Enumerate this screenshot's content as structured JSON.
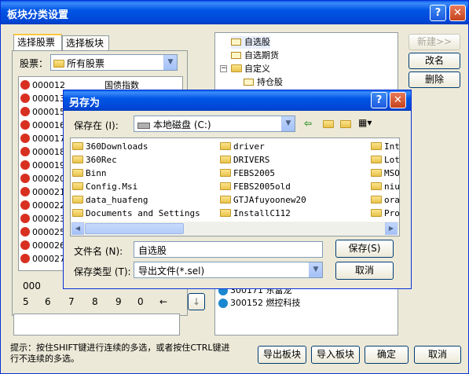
{
  "main": {
    "title": "板块分类设置",
    "help": "?",
    "close": "✕",
    "tabs": [
      "选择股票",
      "选择板块"
    ],
    "stock_label": "股票：",
    "stock_combo": "所有股票",
    "codes": [
      "000012",
      "000013",
      "000015",
      "000016",
      "000017",
      "000018",
      "000019",
      "000020",
      "000021",
      "000022",
      "000023",
      "000025",
      "000026",
      "000027"
    ],
    "first_name": "国债指数",
    "keypad": [
      "000",
      "5",
      "6",
      "7",
      "8",
      "9",
      "0",
      "←"
    ],
    "tree": [
      {
        "label": "自选股",
        "kind": "env"
      },
      {
        "label": "自选期货",
        "kind": "env"
      },
      {
        "label": "自定义",
        "kind": "custom"
      },
      {
        "label": "持仓股",
        "kind": "env"
      }
    ],
    "tree_bottom": [
      {
        "code": "300171",
        "name": "东富龙"
      },
      {
        "code": "300152",
        "name": "燃控科技"
      }
    ],
    "right_buttons": [
      "新建>>",
      "改名",
      "删除"
    ],
    "hint": "提示：按住SHIFT键进行连续的多选，或者按住CTRL键进行不连续的多选。",
    "bottom_buttons": [
      "导出板块",
      "导入板块",
      "确定",
      "取消"
    ]
  },
  "dialog": {
    "title": "另存为",
    "save_in_label": "保存在 (I):",
    "location": "本地磁盘 (C:)",
    "col1": [
      "360Downloads",
      "360Rec",
      "Binn",
      "Config.Msi",
      "data_huafeng",
      "Documents and Settings"
    ],
    "col2": [
      "driver",
      "DRIVERS",
      "FEBS2005",
      "FEBS2005old",
      "GTJAfuyoonew20",
      "InstallC112"
    ],
    "col3": [
      "Int",
      "Lot",
      "MSO",
      "niu",
      "ora",
      "Pro"
    ],
    "filename_label": "文件名 (N):",
    "filename": "自选股",
    "filetype_label": "保存类型 (T):",
    "filetype": "导出文件(*.sel)",
    "save": "保存(S)",
    "cancel": "取消"
  }
}
